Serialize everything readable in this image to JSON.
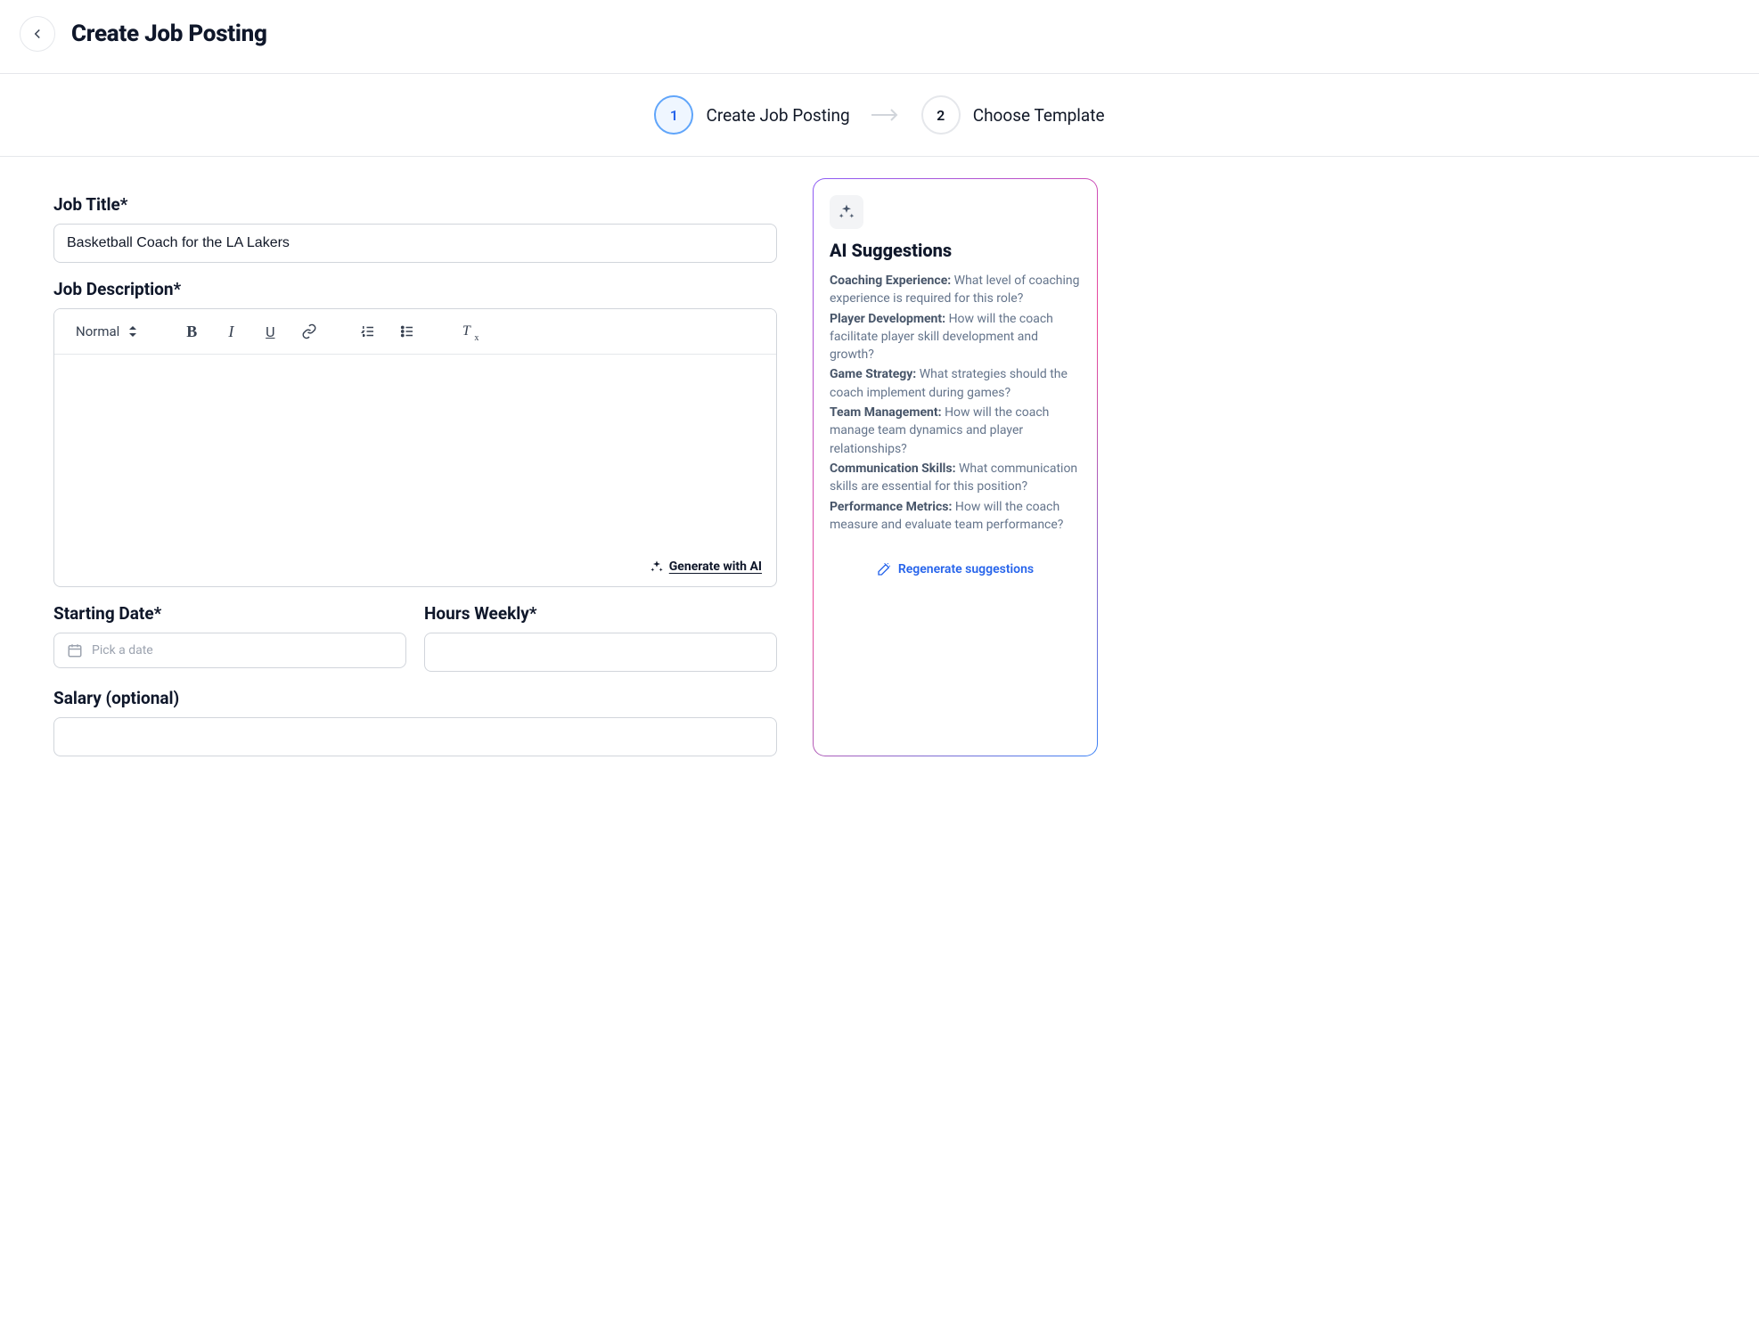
{
  "header": {
    "title": "Create Job Posting"
  },
  "stepper": {
    "steps": [
      {
        "num": "1",
        "label": "Create Job Posting",
        "active": true
      },
      {
        "num": "2",
        "label": "Choose Template",
        "active": false
      }
    ]
  },
  "form": {
    "jobTitle": {
      "label": "Job Title*",
      "value": "Basketball Coach for the LA Lakers"
    },
    "jobDescription": {
      "label": "Job Description*",
      "toolbar": {
        "blockStyle": "Normal"
      },
      "generateLabel": "Generate with AI"
    },
    "startingDate": {
      "label": "Starting Date*",
      "placeholder": "Pick a date"
    },
    "hoursWeekly": {
      "label": "Hours Weekly*",
      "value": ""
    },
    "salary": {
      "label": "Salary (optional)",
      "value": ""
    }
  },
  "aiPanel": {
    "title": "AI Suggestions",
    "suggestions": [
      {
        "heading": "Coaching Experience:",
        "body": "What level of coaching experience is required for this role?"
      },
      {
        "heading": "Player Development:",
        "body": "How will the coach facilitate player skill development and growth?"
      },
      {
        "heading": "Game Strategy:",
        "body": "What strategies should the coach implement during games?"
      },
      {
        "heading": "Team Management:",
        "body": "How will the coach manage team dynamics and player relationships?"
      },
      {
        "heading": "Communication Skills:",
        "body": "What communication skills are essential for this position?"
      },
      {
        "heading": "Performance Metrics:",
        "body": "How will the coach measure and evaluate team performance?"
      }
    ],
    "regenerateLabel": "Regenerate suggestions"
  }
}
